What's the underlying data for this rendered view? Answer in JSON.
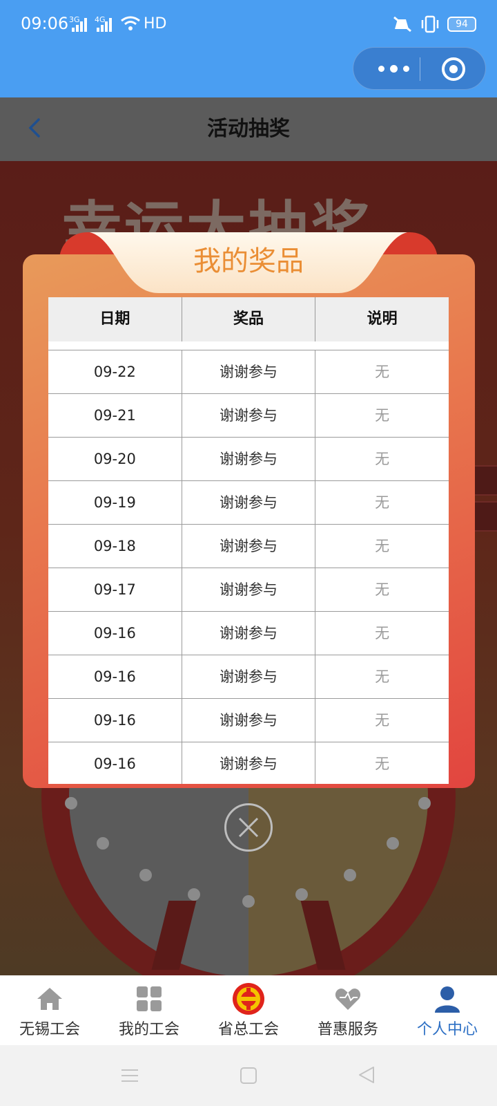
{
  "status_bar": {
    "time": "09:06",
    "network_1": "3G",
    "network_2": "4G",
    "hd": "HD",
    "battery": "94"
  },
  "nav": {
    "title": "活动抽奖"
  },
  "background": {
    "banner_text": "幸运大抽奖"
  },
  "modal": {
    "title": "我的奖品",
    "columns": [
      "日期",
      "奖品",
      "说明"
    ],
    "rows": [
      {
        "date": "09-22",
        "prize": "谢谢参与",
        "note": "无"
      },
      {
        "date": "09-21",
        "prize": "谢谢参与",
        "note": "无"
      },
      {
        "date": "09-20",
        "prize": "谢谢参与",
        "note": "无"
      },
      {
        "date": "09-19",
        "prize": "谢谢参与",
        "note": "无"
      },
      {
        "date": "09-18",
        "prize": "谢谢参与",
        "note": "无"
      },
      {
        "date": "09-17",
        "prize": "谢谢参与",
        "note": "无"
      },
      {
        "date": "09-16",
        "prize": "谢谢参与",
        "note": "无"
      },
      {
        "date": "09-16",
        "prize": "谢谢参与",
        "note": "无"
      },
      {
        "date": "09-16",
        "prize": "谢谢参与",
        "note": "无"
      },
      {
        "date": "09-16",
        "prize": "谢谢参与",
        "note": "无"
      }
    ]
  },
  "tabbar": {
    "items": [
      {
        "label": "无锡工会",
        "icon": "home-icon"
      },
      {
        "label": "我的工会",
        "icon": "grid-icon"
      },
      {
        "label": "省总工会",
        "icon": "union-emblem-icon"
      },
      {
        "label": "普惠服务",
        "icon": "heart-icon"
      },
      {
        "label": "个人中心",
        "icon": "person-icon"
      }
    ],
    "active_index": 4
  },
  "colors": {
    "status_blue": "#4a9ef2",
    "modal_title": "#ea8e35",
    "active_tab": "#2c6fc4"
  }
}
